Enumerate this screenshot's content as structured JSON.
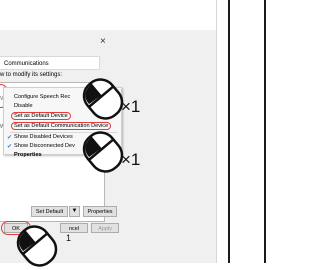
{
  "dialog": {
    "close_glyph": "×",
    "tab_label": "Communications",
    "instruction": "w to modify its settings:",
    "left_text_1": "Vi",
    "left_text_2": "W"
  },
  "context_menu": {
    "items": [
      "Configure Speech Rec",
      "Disable",
      "Set as Default Device",
      "Set as Default Communication Device",
      "Show Disabled Devices",
      "Show Disconnected Dev",
      "Properties"
    ],
    "check_glyph": "✔"
  },
  "buttons": {
    "set_default": "Set Default",
    "dropdown_arrow": "▼",
    "properties": "Properties",
    "ok": "OK",
    "cancel": "ncel",
    "apply": "Apply"
  },
  "annotations": {
    "click_count_1": "×1",
    "click_count_2": "×1",
    "click_count_3": "1"
  },
  "colors": {
    "highlight": "#e23c3c",
    "check": "#3a7bd5"
  }
}
